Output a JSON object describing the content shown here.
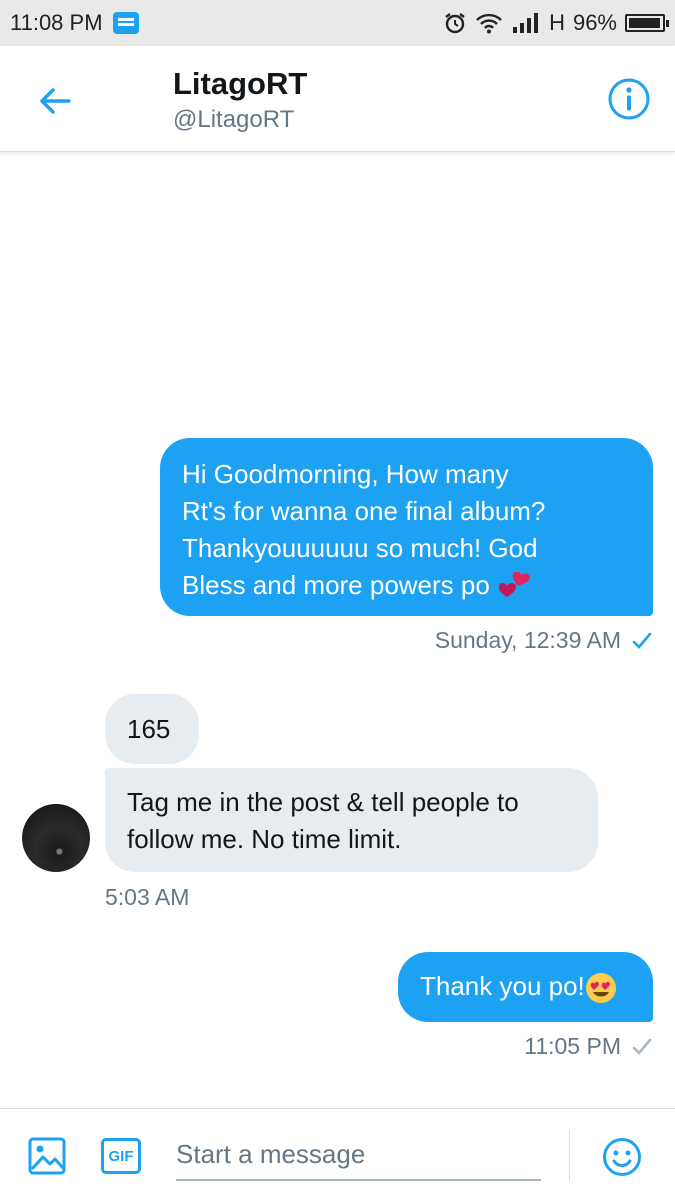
{
  "status_bar": {
    "time": "11:08 PM",
    "network": "H",
    "battery": "96%",
    "battery_level": 0.96,
    "icons": [
      "message-notification-icon",
      "alarm-icon",
      "wifi-icon",
      "signal-icon",
      "battery-icon"
    ]
  },
  "header": {
    "name": "LitagoRT",
    "handle": "@LitagoRT",
    "back_icon": "back-arrow-icon",
    "info_icon": "info-icon"
  },
  "messages": [
    {
      "direction": "outgoing",
      "text": "Hi Goodmorning, How many\nRt's for wanna one final album?\nThankyouuuuuu so much! God\nBless and more powers po",
      "emoji": "two-hearts"
    },
    {
      "direction": "incoming",
      "text": "165"
    },
    {
      "direction": "incoming",
      "text": "Tag me in the post & tell people to\nfollow me. No time limit."
    },
    {
      "direction": "outgoing",
      "text": "Thank you po!",
      "emoji": "heart-eyes"
    }
  ],
  "timestamps": {
    "first": "Sunday, 12:39 AM",
    "second": "5:03 AM",
    "third": "11:05 PM"
  },
  "composer": {
    "placeholder": "Start a message",
    "gif_label": "GIF"
  },
  "colors": {
    "accent": "#1da1f2",
    "incoming_bubble": "#e6ecf0",
    "muted_text": "#657786"
  }
}
